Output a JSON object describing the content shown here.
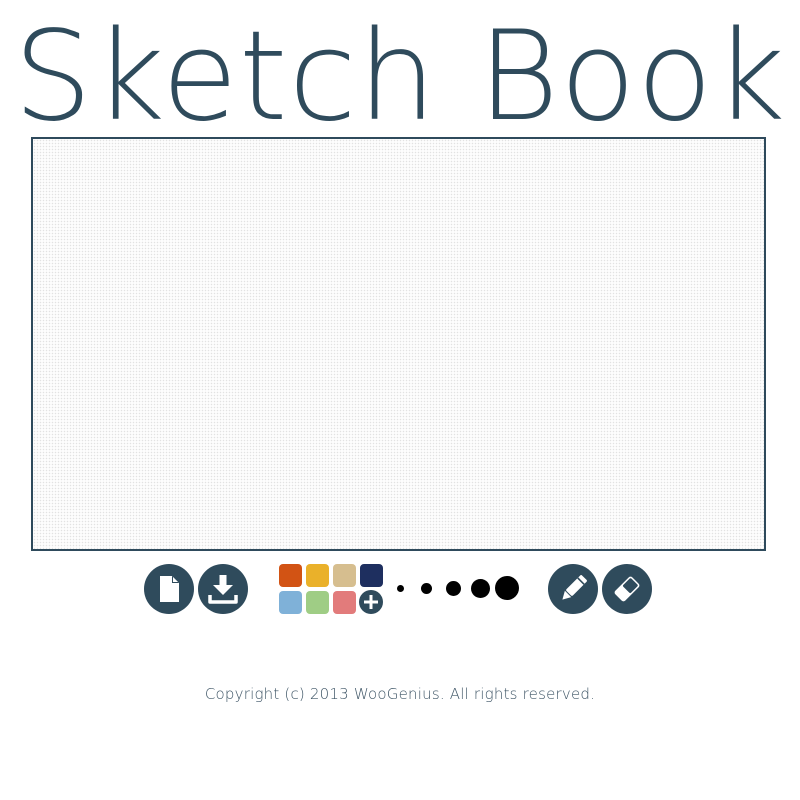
{
  "app": {
    "title": "Sketch Book"
  },
  "colors": {
    "theme": "#2f4b5c",
    "title_text": "#2f4b5c",
    "canvas_border": "#2e4a5c"
  },
  "toolbar": {
    "file_buttons": [
      {
        "name": "new-file-button",
        "icon": "file-icon"
      },
      {
        "name": "download-button",
        "icon": "download-icon"
      }
    ],
    "palette": [
      {
        "color": "#d25314"
      },
      {
        "color": "#eab12a"
      },
      {
        "color": "#d6be8f"
      },
      {
        "color": "#1e2f5f"
      },
      {
        "color": "#7fb1d8"
      },
      {
        "color": "#9fcd85"
      },
      {
        "color": "#e27b7b"
      }
    ],
    "add_color_icon": "plus-icon",
    "brush_sizes": [
      1,
      2,
      3,
      4,
      5
    ],
    "tool_buttons": [
      {
        "name": "pencil-button",
        "icon": "pencil-icon"
      },
      {
        "name": "eraser-button",
        "icon": "eraser-icon"
      }
    ]
  },
  "footer": {
    "copyright": "Copyright (c) 2013 WooGenius. All rights reserved."
  }
}
